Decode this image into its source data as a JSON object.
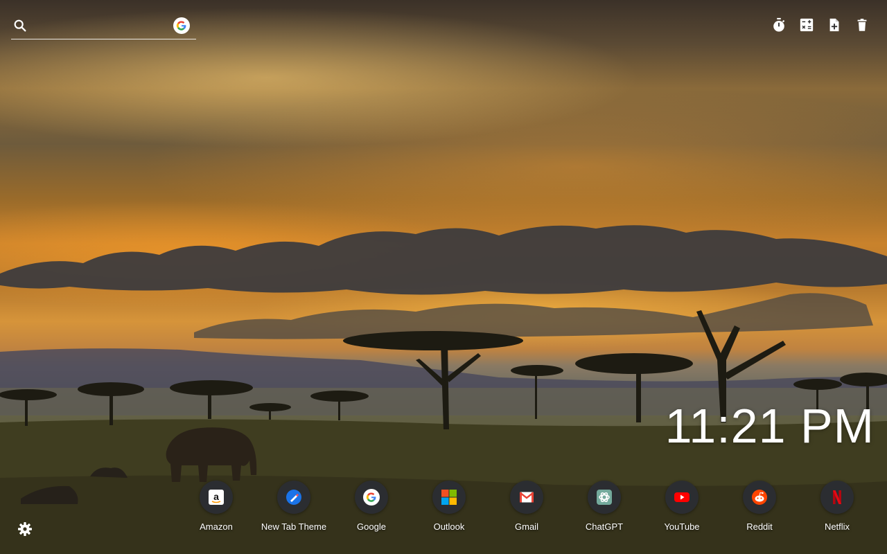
{
  "search": {
    "value": "",
    "placeholder": "",
    "search_icon": "search-icon",
    "engine_icon": "google-g-icon"
  },
  "toolbar": {
    "items": [
      {
        "name": "timer",
        "icon": "stopwatch-icon"
      },
      {
        "name": "calculator",
        "icon": "calculator-icon"
      },
      {
        "name": "add-note",
        "icon": "note-add-icon"
      },
      {
        "name": "delete",
        "icon": "trash-icon"
      }
    ]
  },
  "clock": {
    "time": "11:21 PM"
  },
  "shortcuts": [
    {
      "label": "Amazon",
      "icon": "amazon-icon",
      "color": "#ff9900"
    },
    {
      "label": "New Tab Theme",
      "icon": "new-tab-theme-icon",
      "color": "#1a73e8"
    },
    {
      "label": "Google",
      "icon": "google-icon",
      "color": "#4285f4"
    },
    {
      "label": "Outlook",
      "icon": "microsoft-icon",
      "color": "#f25022"
    },
    {
      "label": "Gmail",
      "icon": "gmail-icon",
      "color": "#ea4335"
    },
    {
      "label": "ChatGPT",
      "icon": "chatgpt-icon",
      "color": "#74aa9c"
    },
    {
      "label": "YouTube",
      "icon": "youtube-icon",
      "color": "#ff0000"
    },
    {
      "label": "Reddit",
      "icon": "reddit-icon",
      "color": "#ff4500"
    },
    {
      "label": "Netflix",
      "icon": "netflix-icon",
      "color": "#e50914"
    }
  ],
  "settings": {
    "icon": "gear-icon"
  }
}
